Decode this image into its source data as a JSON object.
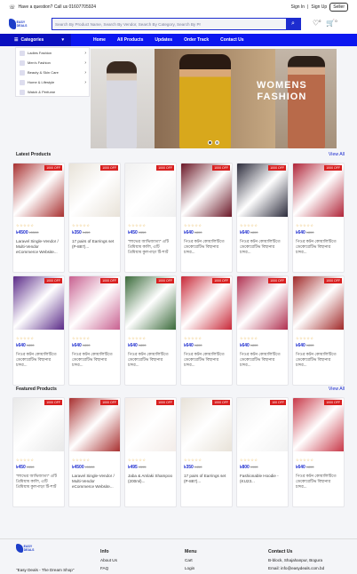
{
  "topbar": {
    "question": "Have a question? Call us 01607705924",
    "sign_in": "Sign In",
    "sign_up": "Sign Up",
    "seller": "Seller"
  },
  "header": {
    "logo": "EASY DEALS",
    "search_placeholder": "Search By Product Name, Search By Vendor, Search By Category, Search By Pr",
    "wishlist_count": "0",
    "cart_count": "0"
  },
  "nav": {
    "categories": "Categories",
    "links": [
      "Home",
      "All Products",
      "Updates",
      "Order Track",
      "Contact Us"
    ]
  },
  "category_menu": [
    "Ladies Fashion",
    "Men's Fashion",
    "Beauty & Skin Care",
    "Home & Lifestyle",
    "Watch & Perfume"
  ],
  "banner": {
    "text1": "WOMENS",
    "text2": "FASHION"
  },
  "latest": {
    "title": "Latest Products",
    "view_all": "View All"
  },
  "featured": {
    "title": "Featured Products",
    "view_all": "View All"
  },
  "latest_products": [
    {
      "off": "1000 OFF",
      "price": "৳4500",
      "old": "৳5500",
      "name": "Laravel Single-Vendor / Multi-Vendor eCommerce Website...",
      "img": "#a83030"
    },
    {
      "off": "1000 OFF",
      "price": "৳350",
      "old": "৳450",
      "name": "17 pairs of Earrings set (P-887)...",
      "img": "#e8e2d8"
    },
    {
      "off": "1000 OFF",
      "price": "৳450",
      "old": "৳550",
      "name": "\"লাভের আভিজাত্য\" এটি প্রিমিয়াম কালি, এটি প্রিমিয়াম কুলপাড়া টি-শার্ট",
      "img": "#f0f0f0"
    },
    {
      "off": "1000 OFF",
      "price": "৳640",
      "old": "৳800",
      "name": "পিওর কটন কোয়ালিটিতে ডেকোরেটিভ বিছানার চাদর...",
      "img": "#6a1626"
    },
    {
      "off": "1000 OFF",
      "price": "৳640",
      "old": "৳800",
      "name": "পিওর কটন কোয়ালিটিতে ডেকোরেটিভ বিছানার চাদর...",
      "img": "#2c2c3c"
    },
    {
      "off": "1000 OFF",
      "price": "৳640",
      "old": "৳800",
      "name": "পিওর কটন কোয়ালিটিতে ডেকোরেটিভ বিছানার চাদর...",
      "img": "#b02438"
    },
    {
      "off": "1000 OFF",
      "price": "৳640",
      "old": "৳800",
      "name": "পিওর কটন কোয়ালিটিতে ডেকোরেটিভ বিছানার চাদর...",
      "img": "#5a2a88"
    },
    {
      "off": "1000 OFF",
      "price": "৳640",
      "old": "৳800",
      "name": "পিওর কটন কোয়ালিটিতে ডেকোরেটিভ বিছানার চাদর...",
      "img": "#c86090"
    },
    {
      "off": "1000 OFF",
      "price": "৳640",
      "old": "৳800",
      "name": "পিওর কটন কোয়ালিটিতে ডেকোরেটিভ বিছানার চাদর...",
      "img": "#3a6a3a"
    },
    {
      "off": "1000 OFF",
      "price": "৳640",
      "old": "৳800",
      "name": "পিওর কটন কোয়ালিটিতে ডেকোরেটিভ বিছানার চাদর...",
      "img": "#c82838"
    },
    {
      "off": "1000 OFF",
      "price": "৳640",
      "old": "৳800",
      "name": "পিওর কটন কোয়ালিটিতে ডেকোরেটিভ বিছানার চাদর...",
      "img": "#b03050"
    },
    {
      "off": "1000 OFF",
      "price": "৳640",
      "old": "৳800",
      "name": "পিওর কটন কোয়ালিটিতে ডেকোরেটিভ বিছানার চাদর...",
      "img": "#a02828"
    }
  ],
  "featured_products": [
    {
      "off": "1000 OFF",
      "price": "৳450",
      "old": "৳550",
      "name": "\"লাভের আভিজাত্য\" এটি প্রিমিয়াম কালি, এটি প্রিমিয়াম কুলপাড়া টি-শার্ট",
      "img": "#e8e8e8"
    },
    {
      "off": "1000 OFF",
      "price": "৳4500",
      "old": "৳5500",
      "name": "Laravel Single-Vendor / Multi-Vendor eCommerce Website...",
      "img": "#a83030"
    },
    {
      "off": "1000 OFF",
      "price": "৳495",
      "old": "৳595",
      "name": "Jaba & Amlaki Shampoo (200ml)...",
      "img": "#f3ece8"
    },
    {
      "off": "1000 OFF",
      "price": "৳350",
      "old": "৳450",
      "name": "17 pairs of Earrings set (P-887)...",
      "img": "#e8e2d8"
    },
    {
      "off": "100 OFF",
      "price": "৳800",
      "old": "৳900",
      "name": "Fashionable Hoodie - (KU23...",
      "img": "#f2f2f2"
    },
    {
      "off": "1000 OFF",
      "price": "৳640",
      "old": "৳800",
      "name": "পিওর কটন কোয়ালিটিতে ডেকোরেটিভ বিছানার চাদর...",
      "img": "#c83848"
    }
  ],
  "footer": {
    "logo": "EASY DEALS",
    "tagline": "\"Easy Deals - The Dream Shop\"",
    "info_title": "Info",
    "info_items": [
      "About Us",
      "FAQ"
    ],
    "menu_title": "Menu",
    "menu_items": [
      "Cart",
      "Login"
    ],
    "contact_title": "Contact Us",
    "contact_items": [
      "B-block, Shajahanpur, Bogura",
      "Email: info@easydeals.com.bd"
    ]
  },
  "colors": {
    "brand": "#0c17f0",
    "sale": "#d81f1f",
    "star": "#e0a020"
  }
}
